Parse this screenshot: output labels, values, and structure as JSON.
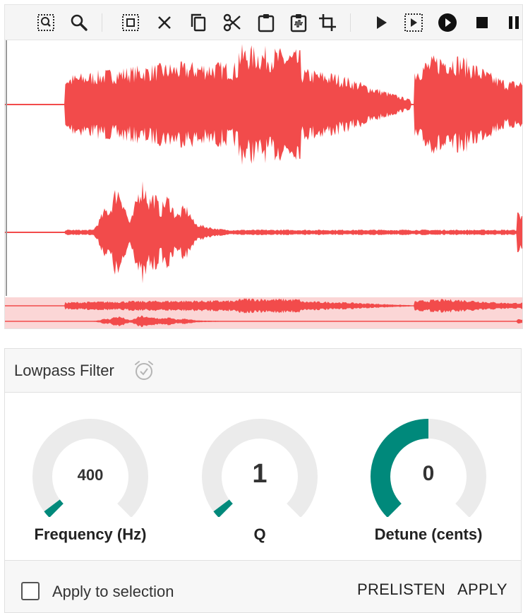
{
  "toolbar": {
    "buttons": [
      {
        "name": "zoom-selection-icon"
      },
      {
        "name": "zoom-icon"
      },
      {
        "name": "select-all-icon"
      },
      {
        "name": "delete-icon"
      },
      {
        "name": "copy-icon"
      },
      {
        "name": "cut-icon"
      },
      {
        "name": "paste-icon"
      },
      {
        "name": "paste-mix-icon"
      },
      {
        "name": "crop-icon"
      },
      {
        "name": "play-icon"
      },
      {
        "name": "play-selection-icon"
      },
      {
        "name": "record-icon"
      },
      {
        "name": "stop-icon"
      },
      {
        "name": "pause-icon"
      }
    ]
  },
  "waveform": {
    "color": "#f24b4b",
    "overview_background": "#fbd6d6"
  },
  "filter_panel": {
    "title": "Lowpass Filter",
    "header_icon": "alarm-check-icon",
    "accent_color": "#00897b",
    "track_color": "#ebebeb",
    "knobs": [
      {
        "value": "400",
        "label": "Frequency (Hz)",
        "level": 0.03
      },
      {
        "value": "1",
        "label": "Q",
        "level": 0.03
      },
      {
        "value": "0",
        "label": "Detune (cents)",
        "level": 0.5
      }
    ]
  },
  "footer": {
    "checkbox_label": "Apply to selection",
    "checkbox_checked": false,
    "prelisten_label": "PRELISTEN",
    "apply_label": "APPLY"
  }
}
